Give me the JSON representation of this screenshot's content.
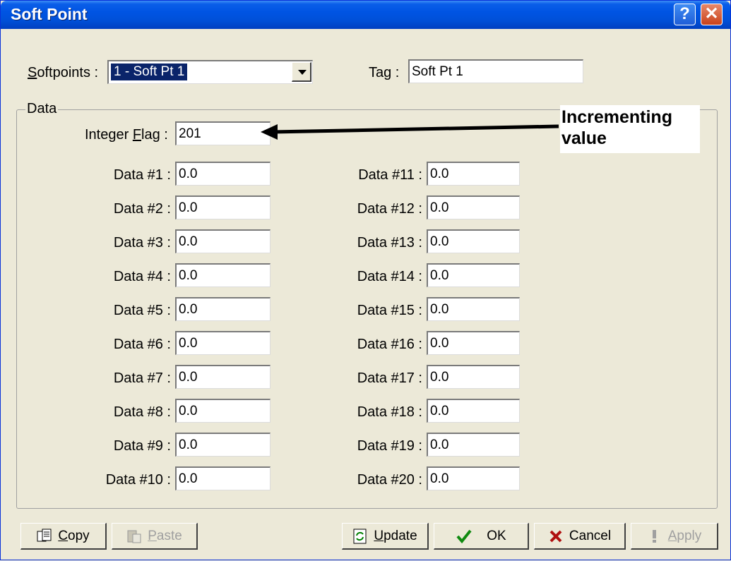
{
  "window": {
    "title": "Soft Point"
  },
  "titlebar": {
    "help_glyph": "?",
    "close_glyph": "✕"
  },
  "softpoints": {
    "label": "Softpoints :",
    "selected": "1 - Soft Pt 1"
  },
  "tag": {
    "label": "Tag :",
    "value": "Soft Pt 1"
  },
  "data_group": {
    "title": "Data"
  },
  "integer_flag": {
    "label": "Integer Flag :",
    "value": "201"
  },
  "callout": {
    "line1": "Incrementing",
    "line2": "value"
  },
  "data_fields": [
    {
      "label": "Data #1 :",
      "value": "0.0"
    },
    {
      "label": "Data #2 :",
      "value": "0.0"
    },
    {
      "label": "Data #3 :",
      "value": "0.0"
    },
    {
      "label": "Data #4 :",
      "value": "0.0"
    },
    {
      "label": "Data #5 :",
      "value": "0.0"
    },
    {
      "label": "Data #6 :",
      "value": "0.0"
    },
    {
      "label": "Data #7 :",
      "value": "0.0"
    },
    {
      "label": "Data #8 :",
      "value": "0.0"
    },
    {
      "label": "Data #9 :",
      "value": "0.0"
    },
    {
      "label": "Data #10 :",
      "value": "0.0"
    },
    {
      "label": "Data #11 :",
      "value": "0.0"
    },
    {
      "label": "Data #12 :",
      "value": "0.0"
    },
    {
      "label": "Data #13 :",
      "value": "0.0"
    },
    {
      "label": "Data #14 :",
      "value": "0.0"
    },
    {
      "label": "Data #15 :",
      "value": "0.0"
    },
    {
      "label": "Data #16 :",
      "value": "0.0"
    },
    {
      "label": "Data #17 :",
      "value": "0.0"
    },
    {
      "label": "Data #18 :",
      "value": "0.0"
    },
    {
      "label": "Data #19 :",
      "value": "0.0"
    },
    {
      "label": "Data #20 :",
      "value": "0.0"
    }
  ],
  "buttons": {
    "copy": "Copy",
    "paste": "Paste",
    "update": "Update",
    "ok": "OK",
    "cancel": "Cancel",
    "apply": "Apply"
  }
}
